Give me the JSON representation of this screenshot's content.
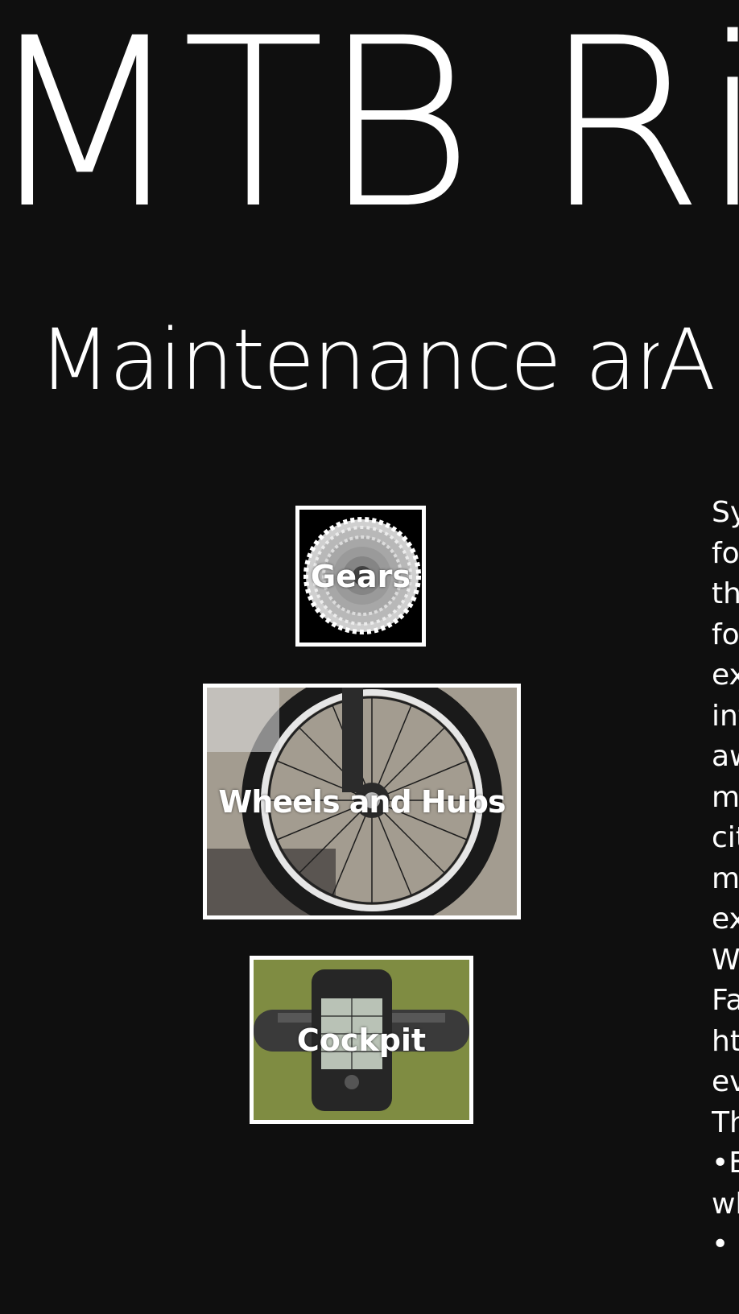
{
  "app": {
    "title": "MTB Rid"
  },
  "pivot": {
    "items": [
      {
        "label": "Maintenance ar"
      },
      {
        "label": "A"
      }
    ]
  },
  "tiles": [
    {
      "label": "Gears",
      "icon": "cassette-image"
    },
    {
      "label": "Wheels and Hubs",
      "icon": "wheel-image"
    },
    {
      "label": "Cockpit",
      "icon": "handlebar-gps-image"
    }
  ],
  "description": {
    "lines": [
      "Sy",
      "fo",
      "th",
      "fo",
      "ex",
      "int",
      "aw",
      "m",
      "cit",
      "m",
      "ex",
      "W",
      "Fa",
      "ht",
      "ev",
      "Th",
      "•E",
      "wh",
      "•"
    ]
  },
  "colors": {
    "background": "#0f0f0f",
    "text": "#ffffff",
    "tile_border": "#ffffff"
  }
}
